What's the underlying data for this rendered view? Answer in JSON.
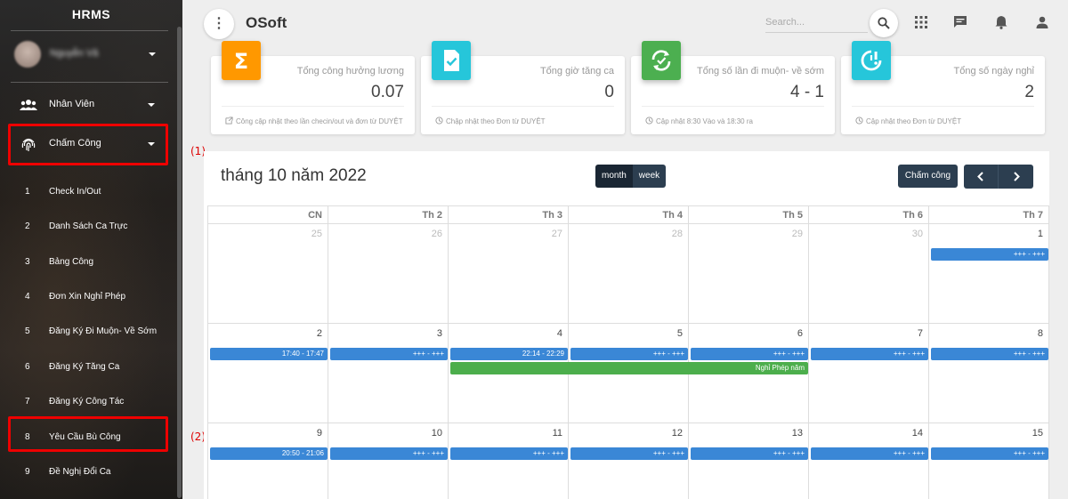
{
  "sidebar": {
    "brand": "HRMS",
    "user_name": "Nguyễn Vă",
    "menu": [
      {
        "label": "Nhân Viên",
        "icon": "users-icon"
      },
      {
        "label": "Chấm Công",
        "icon": "fingerprint-icon"
      }
    ],
    "sub_items": [
      {
        "num": "1",
        "label": "Check In/Out"
      },
      {
        "num": "2",
        "label": "Danh Sách Ca Trực"
      },
      {
        "num": "3",
        "label": "Bảng Công"
      },
      {
        "num": "4",
        "label": "Đơn Xin Nghỉ Phép"
      },
      {
        "num": "5",
        "label": "Đăng Ký Đi Muộn- Về Sớm"
      },
      {
        "num": "6",
        "label": "Đăng Ký Tăng Ca"
      },
      {
        "num": "7",
        "label": "Đăng Ký Công Tác"
      },
      {
        "num": "8",
        "label": "Yêu Cầu Bù Công"
      },
      {
        "num": "9",
        "label": "Đề Nghị Đổi Ca"
      }
    ]
  },
  "callouts": {
    "one": "(1)",
    "two": "(2)"
  },
  "header": {
    "title": "OSoft",
    "search_placeholder": "Search...",
    "icons": [
      "search-icon",
      "apps-grid-icon",
      "chat-icon",
      "bell-icon",
      "user-icon"
    ]
  },
  "cards": [
    {
      "label": "Tổng công hưởng lương",
      "value": "0.07",
      "footer": "Công cập nhật theo lần checin/out và đơn từ DUYỆT",
      "color": "#ff9800",
      "icon": "sigma-icon",
      "footer_icon": "external-link-icon"
    },
    {
      "label": "Tổng giờ tăng ca",
      "value": "0",
      "footer": "Chập nhật theo Đơn từ DUYỆT",
      "color": "#26c6da",
      "icon": "file-check-icon",
      "footer_icon": "clock-icon"
    },
    {
      "label": "Tổng số lần đi muộn- về sớm",
      "value": "4 - 1",
      "footer": "Cập nhật 8:30 Vào và 18:30 ra",
      "color": "#4caf50",
      "icon": "sync-check-icon",
      "footer_icon": "clock-icon"
    },
    {
      "label": "Tổng số ngày nghỉ",
      "value": "2",
      "footer": "Cập nhật theo Đơn từ DUYỆT",
      "color": "#26c6da",
      "icon": "clock-alert-icon",
      "footer_icon": "clock-icon"
    }
  ],
  "calendar": {
    "title": "tháng 10 năm 2022",
    "view_month": "month",
    "view_week": "week",
    "attend_button": "Chấm công",
    "weekdays": [
      "CN",
      "Th 2",
      "Th 3",
      "Th 4",
      "Th 5",
      "Th 6",
      "Th 7"
    ],
    "weeks": [
      {
        "days": [
          {
            "n": "25",
            "other": true
          },
          {
            "n": "26",
            "other": true
          },
          {
            "n": "27",
            "other": true
          },
          {
            "n": "28",
            "other": true
          },
          {
            "n": "29",
            "other": true
          },
          {
            "n": "30",
            "other": true
          },
          {
            "n": "1",
            "other": false
          }
        ]
      },
      {
        "days": [
          {
            "n": "2",
            "other": false
          },
          {
            "n": "3",
            "other": false
          },
          {
            "n": "4",
            "other": false
          },
          {
            "n": "5",
            "other": false
          },
          {
            "n": "6",
            "other": false
          },
          {
            "n": "7",
            "other": false
          },
          {
            "n": "8",
            "other": false
          }
        ]
      },
      {
        "days": [
          {
            "n": "9",
            "other": false
          },
          {
            "n": "10",
            "other": false
          },
          {
            "n": "11",
            "other": false
          },
          {
            "n": "12",
            "other": false
          },
          {
            "n": "13",
            "other": false
          },
          {
            "n": "14",
            "other": false
          },
          {
            "n": "15",
            "other": false
          }
        ]
      }
    ],
    "events": [
      {
        "week": 0,
        "day": 6,
        "span": 1,
        "row": 0,
        "text": "+++ - +++",
        "color": "blue"
      },
      {
        "week": 1,
        "day": 0,
        "span": 1,
        "row": 0,
        "text": "17:40 - 17:47",
        "color": "blue"
      },
      {
        "week": 1,
        "day": 1,
        "span": 1,
        "row": 0,
        "text": "+++ - +++",
        "color": "blue"
      },
      {
        "week": 1,
        "day": 2,
        "span": 1,
        "row": 0,
        "text": "22:14 - 22:29",
        "color": "blue"
      },
      {
        "week": 1,
        "day": 3,
        "span": 1,
        "row": 0,
        "text": "+++ - +++",
        "color": "blue"
      },
      {
        "week": 1,
        "day": 4,
        "span": 1,
        "row": 0,
        "text": "+++ - +++",
        "color": "blue"
      },
      {
        "week": 1,
        "day": 5,
        "span": 1,
        "row": 0,
        "text": "+++ - +++",
        "color": "blue"
      },
      {
        "week": 1,
        "day": 6,
        "span": 1,
        "row": 0,
        "text": "+++ - +++",
        "color": "blue"
      },
      {
        "week": 1,
        "day": 2,
        "span": 3,
        "row": 1,
        "text": "Nghỉ Phép năm",
        "color": "green"
      },
      {
        "week": 2,
        "day": 0,
        "span": 1,
        "row": 0,
        "text": "20:50 - 21:06",
        "color": "blue"
      },
      {
        "week": 2,
        "day": 1,
        "span": 1,
        "row": 0,
        "text": "+++ - +++",
        "color": "blue"
      },
      {
        "week": 2,
        "day": 2,
        "span": 1,
        "row": 0,
        "text": "+++ - +++",
        "color": "blue"
      },
      {
        "week": 2,
        "day": 3,
        "span": 1,
        "row": 0,
        "text": "+++ - +++",
        "color": "blue"
      },
      {
        "week": 2,
        "day": 4,
        "span": 1,
        "row": 0,
        "text": "+++ - +++",
        "color": "blue"
      },
      {
        "week": 2,
        "day": 5,
        "span": 1,
        "row": 0,
        "text": "+++ - +++",
        "color": "blue"
      },
      {
        "week": 2,
        "day": 6,
        "span": 1,
        "row": 0,
        "text": "+++ - +++",
        "color": "blue"
      }
    ]
  }
}
